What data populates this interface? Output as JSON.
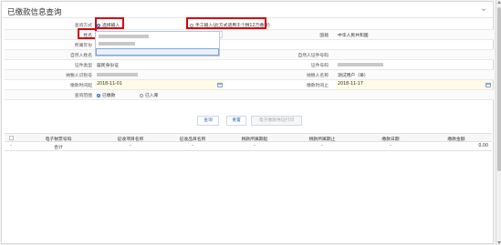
{
  "panel": {
    "title": "已缴款信息查询"
  },
  "form": {
    "query_mode": {
      "label": "查询方式",
      "option_select": "选择输入",
      "option_manual": "手工输入(此方式适用于个税12万缴存)"
    },
    "name": {
      "label": "姓名",
      "value": ""
    },
    "country": {
      "label": "国籍",
      "value": "中华人民共和国"
    },
    "unit_level": {
      "label": "所属年份",
      "value": ""
    },
    "other_person": {
      "label": "自然人姓名",
      "value": ""
    },
    "other_id_label": "自然人证件号码",
    "id_type": {
      "label": "证件类型",
      "value": "居民身份证"
    },
    "id_number": {
      "label": "证件号码",
      "value": ""
    },
    "taxpayer_id": {
      "label": "纳税人识别号",
      "value": ""
    },
    "taxpayer_name": {
      "label": "纳税人名称",
      "value": "测试用户（单）"
    },
    "start_date": {
      "label": "缴款时间起",
      "value": "2018-11-01"
    },
    "end_date": {
      "label": "缴款时间止",
      "value": "2018-11-17"
    },
    "scope": {
      "label": "查询范围",
      "option_a": "已缴款",
      "option_b": "已入库"
    }
  },
  "buttons": {
    "query": "查询",
    "reset": "重置",
    "print": "电子缴款凭证打印"
  },
  "grid": {
    "columns": [
      "电子税票号码",
      "征收项目名称",
      "征收品目名称",
      "税款所属期起",
      "税款所属期止",
      "缴款日期",
      "缴款金额"
    ],
    "total_row": {
      "label": "合计",
      "c1": "-",
      "c2": "-",
      "c3": "-",
      "c4": "-",
      "c5": "-",
      "amount": "0.00"
    }
  }
}
